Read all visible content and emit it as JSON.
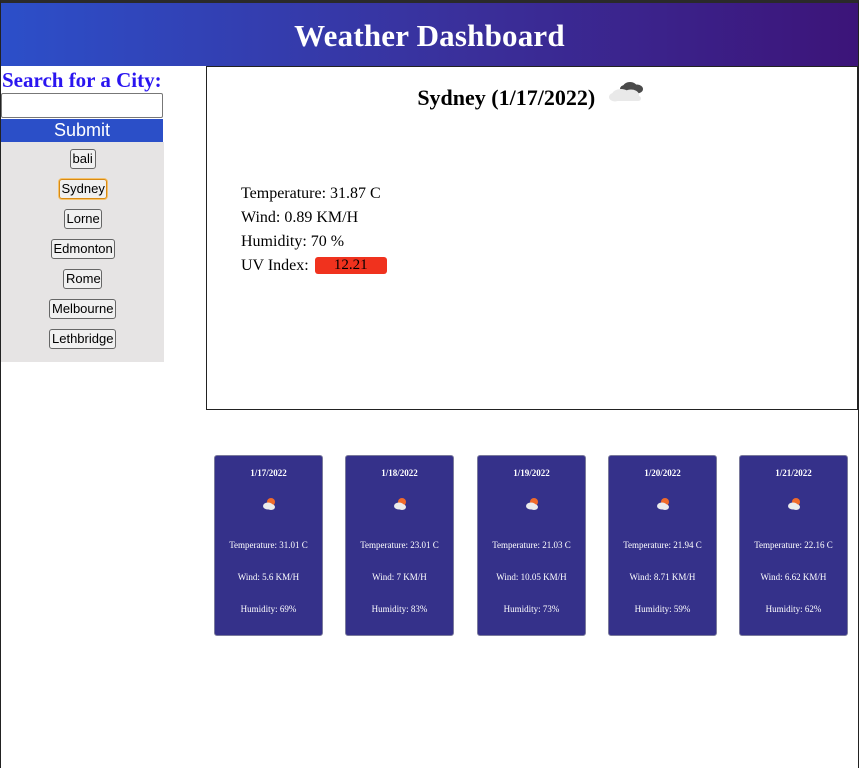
{
  "header": {
    "title": "Weather Dashboard"
  },
  "sidebar": {
    "search_heading": "Search for a City:",
    "search_value": "",
    "search_placeholder": "",
    "submit_label": "Submit",
    "history": [
      {
        "label": "bali",
        "active": false
      },
      {
        "label": "Sydney",
        "active": true
      },
      {
        "label": "Lorne",
        "active": false
      },
      {
        "label": "Edmonton",
        "active": false
      },
      {
        "label": "Rome",
        "active": false
      },
      {
        "label": "Melbourne",
        "active": false
      },
      {
        "label": "Lethbridge",
        "active": false
      }
    ]
  },
  "current": {
    "title": "Sydney (1/17/2022)",
    "icon": "broken-clouds-icon",
    "temperature": "Temperature: 31.87 C",
    "wind": "Wind: 0.89 KM/H",
    "humidity": "Humidity: 70 %",
    "uv_label": "UV Index:",
    "uv_value": "12.21",
    "uv_color": "#f0321e"
  },
  "forecast": [
    {
      "date": "1/17/2022",
      "icon": "partly-cloudy-day-icon",
      "temperature": "Temperature: 31.01 C",
      "wind": "Wind: 5.6 KM/H",
      "humidity": "Humidity: 69%"
    },
    {
      "date": "1/18/2022",
      "icon": "partly-cloudy-day-icon",
      "temperature": "Temperature: 23.01 C",
      "wind": "Wind: 7 KM/H",
      "humidity": "Humidity: 83%"
    },
    {
      "date": "1/19/2022",
      "icon": "partly-cloudy-day-icon",
      "temperature": "Temperature: 21.03 C",
      "wind": "Wind: 10.05 KM/H",
      "humidity": "Humidity: 73%"
    },
    {
      "date": "1/20/2022",
      "icon": "partly-cloudy-day-icon",
      "temperature": "Temperature: 21.94 C",
      "wind": "Wind: 8.71 KM/H",
      "humidity": "Humidity: 59%"
    },
    {
      "date": "1/21/2022",
      "icon": "partly-cloudy-day-icon",
      "temperature": "Temperature: 22.16 C",
      "wind": "Wind: 6.62 KM/H",
      "humidity": "Humidity: 62%"
    }
  ],
  "colors": {
    "header_start": "#2c4fc9",
    "header_end": "#3c1479",
    "search_heading": "#2a15f0",
    "submit_bg": "#2b4fc8",
    "card_bg": "#35318a",
    "history_bg": "#e6e4e4"
  }
}
